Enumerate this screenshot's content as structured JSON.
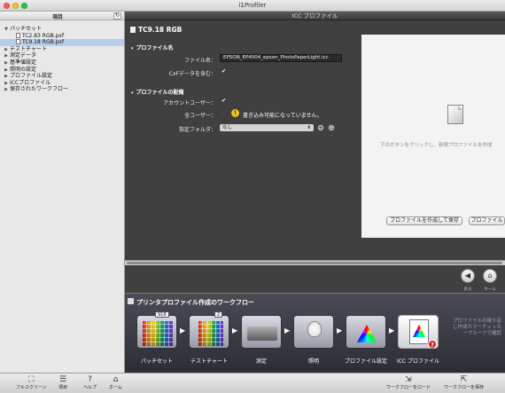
{
  "window": {
    "title": "i1Profiler"
  },
  "sidebar": {
    "header": "項目",
    "refresh_icon": "refresh-icon",
    "tree": [
      {
        "label": "パッチセット",
        "expanded": true
      },
      {
        "label": "TC2.83 RGB.pxf",
        "child": true
      },
      {
        "label": "TC9.18 RGB.pxf",
        "child": true,
        "selected": true
      },
      {
        "label": "テストチャート"
      },
      {
        "label": "測定データ"
      },
      {
        "label": "基準値設定"
      },
      {
        "label": "照明の設定"
      },
      {
        "label": "プロファイル設定"
      },
      {
        "label": "ICCプロファイル"
      },
      {
        "label": "保存されたワークフロー"
      }
    ]
  },
  "main": {
    "header": "ICC プロファイル",
    "document_title": "TC9.18 RGB",
    "profile_name_section": {
      "title": "プロファイル名",
      "filename_label": "ファイル名：",
      "filename_value": "EPSON_EP4004_epson_PhotoPaperLight.icc",
      "cxf_label": "CxFデータを含む：",
      "cxf_checked": true
    },
    "deployment_section": {
      "title": "プロファイルの配備",
      "account_user_label": "アカウントユーザー：",
      "account_user_checked": true,
      "all_users_label": "全ユーザー：",
      "all_users_warning": "書き込み可能になっていません。",
      "folder_label": "指定フォルダ：",
      "folder_value": "なし"
    },
    "preview": {
      "hint": "下のボタンをクリックし、新規プロファイルを作成",
      "create_save_button": "プロファイルを作成して保存",
      "second_button": "プロファイル"
    },
    "nav": {
      "back_label": "戻る",
      "home_label": "ホーム"
    }
  },
  "workflow": {
    "title": "プリンタプロファイル作成のワークフロー",
    "steps": [
      {
        "label": "パッチセット",
        "badge": "918"
      },
      {
        "label": "テストチャート",
        "badge": "2"
      },
      {
        "label": "測定"
      },
      {
        "label": "照明"
      },
      {
        "label": "プロファイル設定"
      },
      {
        "label": "ICC プロファイル"
      }
    ],
    "side_text": "プロファイルの繰り返し作成カラーチェッカープルーフで確認"
  },
  "toolbar": {
    "fullscreen": "フルスクリーン",
    "items": "項目",
    "help": "ヘルプ",
    "home": "ホーム",
    "load_workflow": "ワークフローをロード",
    "save_workflow": "ワークフローを保存"
  }
}
